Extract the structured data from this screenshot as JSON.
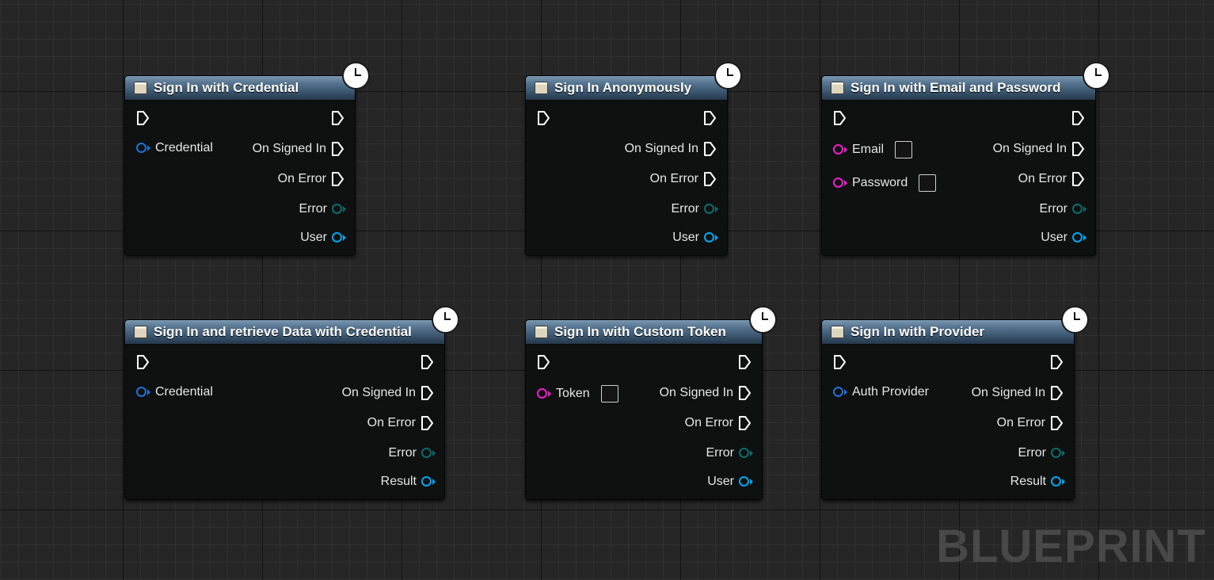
{
  "nodes": [
    {
      "title": "Sign In with Credential",
      "inputs": [
        {
          "label": "Credential",
          "pin": "blue-struct",
          "checkbox": false
        }
      ],
      "outputs": [
        {
          "label": "On Signed In",
          "pin": "exec"
        },
        {
          "label": "On Error",
          "pin": "exec"
        },
        {
          "label": "Error",
          "pin": "teal-struct"
        },
        {
          "label": "User",
          "pin": "object"
        }
      ]
    },
    {
      "title": "Sign In Anonymously",
      "inputs": [],
      "outputs": [
        {
          "label": "On Signed In",
          "pin": "exec"
        },
        {
          "label": "On Error",
          "pin": "exec"
        },
        {
          "label": "Error",
          "pin": "teal-struct"
        },
        {
          "label": "User",
          "pin": "object"
        }
      ]
    },
    {
      "title": "Sign In with Email and Password",
      "inputs": [
        {
          "label": "Email",
          "pin": "pink-string",
          "checkbox": true
        },
        {
          "label": "Password",
          "pin": "pink-string",
          "checkbox": true
        }
      ],
      "outputs": [
        {
          "label": "On Signed In",
          "pin": "exec"
        },
        {
          "label": "On Error",
          "pin": "exec"
        },
        {
          "label": "Error",
          "pin": "teal-struct"
        },
        {
          "label": "User",
          "pin": "object"
        }
      ]
    },
    {
      "title": "Sign In and retrieve Data with Credential",
      "inputs": [
        {
          "label": "Credential",
          "pin": "blue-struct",
          "checkbox": false
        }
      ],
      "outputs": [
        {
          "label": "On Signed In",
          "pin": "exec"
        },
        {
          "label": "On Error",
          "pin": "exec"
        },
        {
          "label": "Error",
          "pin": "teal-struct"
        },
        {
          "label": "Result",
          "pin": "object"
        }
      ]
    },
    {
      "title": "Sign In with Custom Token",
      "inputs": [
        {
          "label": "Token",
          "pin": "pink-string",
          "checkbox": true
        }
      ],
      "outputs": [
        {
          "label": "On Signed In",
          "pin": "exec"
        },
        {
          "label": "On Error",
          "pin": "exec"
        },
        {
          "label": "Error",
          "pin": "teal-struct"
        },
        {
          "label": "User",
          "pin": "object"
        }
      ]
    },
    {
      "title": "Sign In with Provider",
      "inputs": [
        {
          "label": "Auth Provider",
          "pin": "blue-struct",
          "checkbox": false
        }
      ],
      "outputs": [
        {
          "label": "On Signed In",
          "pin": "exec"
        },
        {
          "label": "On Error",
          "pin": "exec"
        },
        {
          "label": "Error",
          "pin": "teal-struct"
        },
        {
          "label": "Result",
          "pin": "object"
        }
      ]
    }
  ],
  "icons": {
    "header": "function-icon",
    "corner": "clock-icon",
    "exec": "exec-pin-icon"
  },
  "colors": {
    "background": "#262626",
    "exec_pin": "#ffffff",
    "struct_pin": "#1f72d6",
    "object_pin": "#00a8f2",
    "error_pin": "#0c6c69",
    "string_pin": "#f01cd0"
  },
  "watermark": "BLUEPRINT"
}
